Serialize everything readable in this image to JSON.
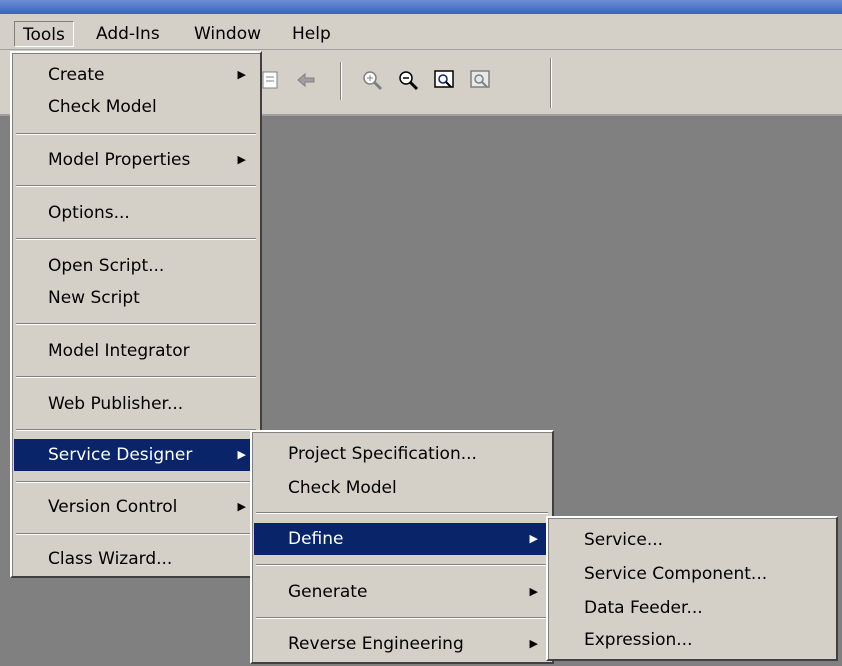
{
  "menubar": {
    "items": [
      {
        "label": "Tools"
      },
      {
        "label": "Add-Ins"
      },
      {
        "label": "Window"
      },
      {
        "label": "Help"
      }
    ]
  },
  "tools_menu": {
    "items": [
      {
        "label": "Create",
        "submenu": true
      },
      {
        "label": "Check Model"
      },
      {
        "label": "Model Properties",
        "submenu": true
      },
      {
        "label": "Options..."
      },
      {
        "label": "Open Script..."
      },
      {
        "label": "New Script"
      },
      {
        "label": "Model Integrator"
      },
      {
        "label": "Web Publisher..."
      },
      {
        "label": "Service Designer",
        "submenu": true,
        "highlighted": true
      },
      {
        "label": "Version Control",
        "submenu": true
      },
      {
        "label": "Class Wizard..."
      }
    ]
  },
  "service_designer_menu": {
    "items": [
      {
        "label": "Project Specification..."
      },
      {
        "label": "Check Model"
      },
      {
        "label": "Define",
        "submenu": true,
        "highlighted": true
      },
      {
        "label": "Generate",
        "submenu": true
      },
      {
        "label": "Reverse Engineering",
        "submenu": true
      }
    ]
  },
  "define_menu": {
    "items": [
      {
        "label": "Service..."
      },
      {
        "label": "Service Component..."
      },
      {
        "label": "Data Feeder..."
      },
      {
        "label": "Expression..."
      }
    ]
  },
  "toolbar": {
    "icons": [
      "browse-icon",
      "back-arrow-icon",
      "zoom-in-icon",
      "zoom-out-icon",
      "fit-in-window-icon",
      "undo-fit-icon"
    ]
  },
  "colors": {
    "highlight": "#0a246a",
    "menu_bg": "#d4d0c8",
    "workspace": "#808080"
  },
  "glyphs": {
    "submenu_arrow": "▶"
  }
}
